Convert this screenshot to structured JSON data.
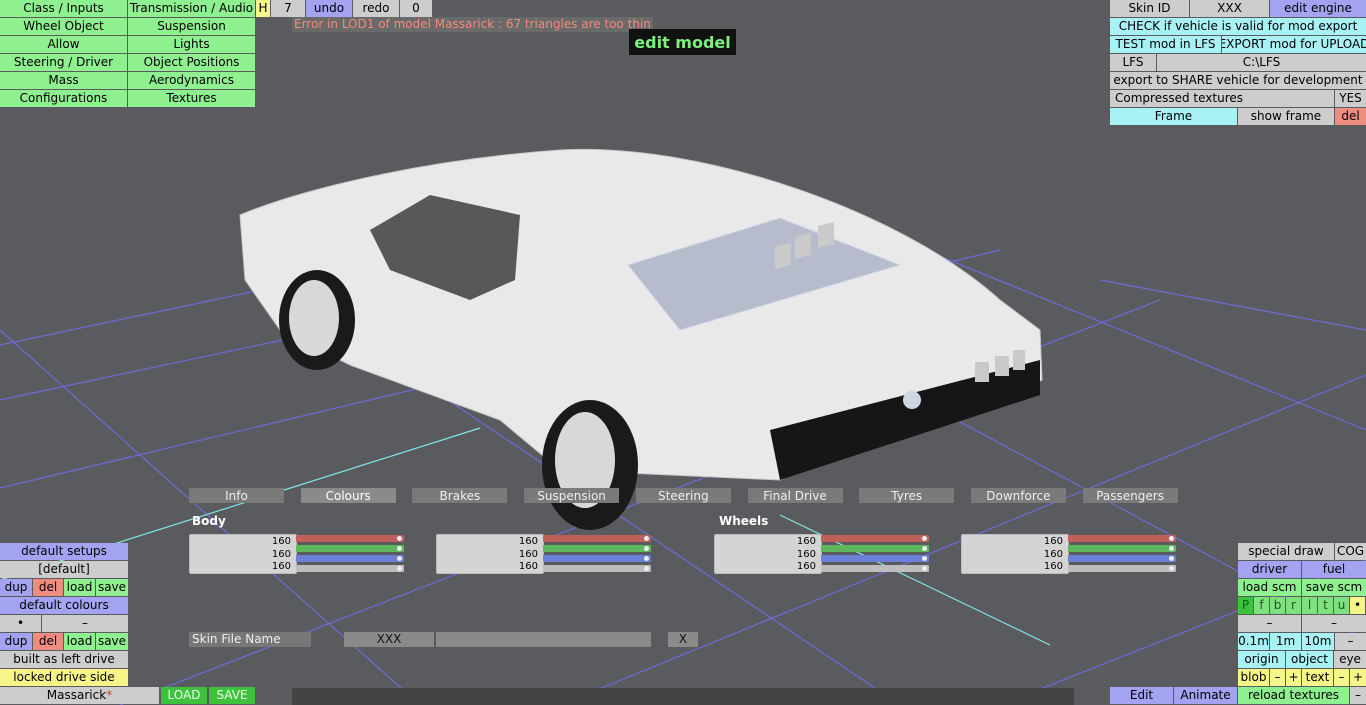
{
  "title": "edit model",
  "error": "Error in LOD1 of model Massarick : 67 triangles are too thin",
  "left_menu": [
    [
      "Class / Inputs",
      "Transmission / Audio"
    ],
    [
      "Wheel Object",
      "Suspension"
    ],
    [
      "Allow",
      "Lights"
    ],
    [
      "Steering / Driver",
      "Object Positions"
    ],
    [
      "Mass",
      "Aerodynamics"
    ],
    [
      "Configurations",
      "Textures"
    ]
  ],
  "top_small": {
    "h": "H",
    "count": "7",
    "undo": "undo",
    "redo": "redo",
    "zero": "0"
  },
  "right_panel": {
    "skin_id_label": "Skin ID",
    "skin_id_value": "XXX",
    "edit_engine": "edit engine",
    "check_valid": "CHECK if vehicle is valid for mod export",
    "test_mod": "TEST mod in LFS",
    "export_mod": "EXPORT mod for UPLOAD",
    "lfs_label": "LFS",
    "lfs_path": "C:\\LFS",
    "export_share": "export to SHARE vehicle for development",
    "compressed_label": "Compressed textures",
    "compressed_value": "YES",
    "frame": "Frame",
    "show_frame": "show frame",
    "del": "del"
  },
  "tabs": [
    "Info",
    "Colours",
    "Brakes",
    "Suspension",
    "Steering",
    "Final Drive",
    "Tyres",
    "Downforce",
    "Passengers"
  ],
  "active_tab": "Colours",
  "colour_groups": {
    "body": "Body",
    "wheels": "Wheels"
  },
  "colour_values": [
    "160",
    "160",
    "160"
  ],
  "colour_colors": {
    "red": "#c0605a",
    "green": "#5db85d",
    "blue": "#6a7fd6",
    "gray": "#bdbdbd"
  },
  "skin_file": {
    "label": "Skin File Name",
    "value": "XXX",
    "close": "X"
  },
  "bottom_left": {
    "default_setups": "default setups",
    "default_tag": "[default]",
    "dup": "dup",
    "del": "del",
    "load": "load",
    "save": "save",
    "default_colours": "default colours",
    "dot": "•",
    "dash": "–",
    "built_as_left": "built as left drive",
    "locked_drive": "locked drive side",
    "model_name": "Massarick",
    "model_star": "*",
    "load_btn": "LOAD",
    "save_btn": "SAVE"
  },
  "bottom_right": {
    "special_draw": "special draw",
    "cog": "COG",
    "driver": "driver",
    "fuel": "fuel",
    "load_scm": "load scm",
    "save_scm": "save scm",
    "letters": [
      "P",
      "f",
      "b",
      "r",
      "l",
      "t",
      "u",
      "•"
    ],
    "dash": "–",
    "scales": [
      "0.1m",
      "1m",
      "10m",
      "–"
    ],
    "origin": "origin",
    "object": "object",
    "eye": "eye",
    "blob": "blob",
    "minus": "–",
    "plus": "+",
    "text": "text",
    "edit": "Edit",
    "animate": "Animate",
    "reload_textures": "reload textures"
  }
}
